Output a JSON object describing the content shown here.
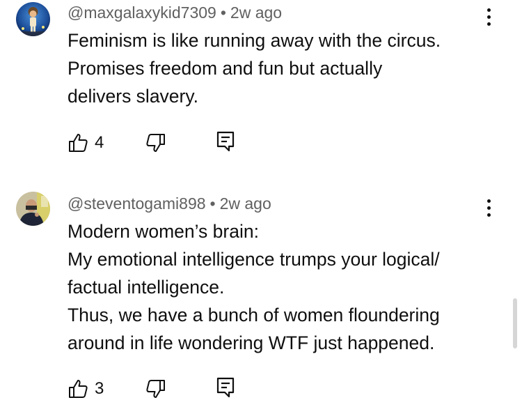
{
  "comments": [
    {
      "author": "@maxgalaxykid7309",
      "separator": "•",
      "time": "2w ago",
      "lines": [
        "Feminism is like running away with the circus.",
        "Promises freedom and fun but actually",
        "delivers slavery."
      ],
      "likes": "4",
      "avatar_icon": "cartoon-avatar",
      "actions": [
        "thumb-up-icon",
        "thumb-down-icon",
        "reply-icon"
      ],
      "menu_icon": "more-vertical-icon"
    },
    {
      "author": "@steventogami898",
      "separator": "•",
      "time": "2w ago",
      "lines": [
        "Modern women’s brain:",
        "My emotional intelligence trumps your logical/",
        "factual intelligence.",
        "Thus, we have a bunch of women floundering",
        "around in life wondering WTF just happened."
      ],
      "likes": "3",
      "avatar_icon": "photo-avatar",
      "actions": [
        "thumb-up-icon",
        "thumb-down-icon",
        "reply-icon"
      ],
      "menu_icon": "more-vertical-icon"
    }
  ],
  "colors": {
    "text": "#0f0f0f",
    "meta": "#606060",
    "background": "#ffffff",
    "scrollbar": "#d6d6d6"
  }
}
